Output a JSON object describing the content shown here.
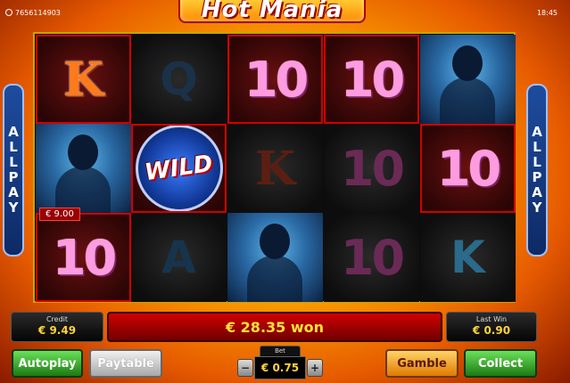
{
  "session_id": "7656114903",
  "clock": "18:45",
  "logo_text": "Hot Mania",
  "side_banner": [
    "A",
    "L",
    "L",
    "P",
    "A",
    "Y"
  ],
  "reels": [
    [
      "K",
      "woman",
      "10"
    ],
    [
      "Q",
      "WILD",
      "A"
    ],
    [
      "10",
      "K",
      "woman"
    ],
    [
      "10",
      "10",
      "10"
    ],
    [
      "woman",
      "10",
      "K"
    ]
  ],
  "win_label": "€ 9.00",
  "credit": {
    "label": "Credit",
    "value": "€ 9.49"
  },
  "won_text": "€ 28.35 won",
  "last_win": {
    "label": "Last Win",
    "value": "€ 0.90"
  },
  "bet": {
    "label": "Bet",
    "value": "€ 0.75",
    "minus": "−",
    "plus": "+"
  },
  "buttons": {
    "autoplay": "Autoplay",
    "paytable": "Paytable",
    "gamble": "Gamble",
    "collect": "Collect"
  }
}
